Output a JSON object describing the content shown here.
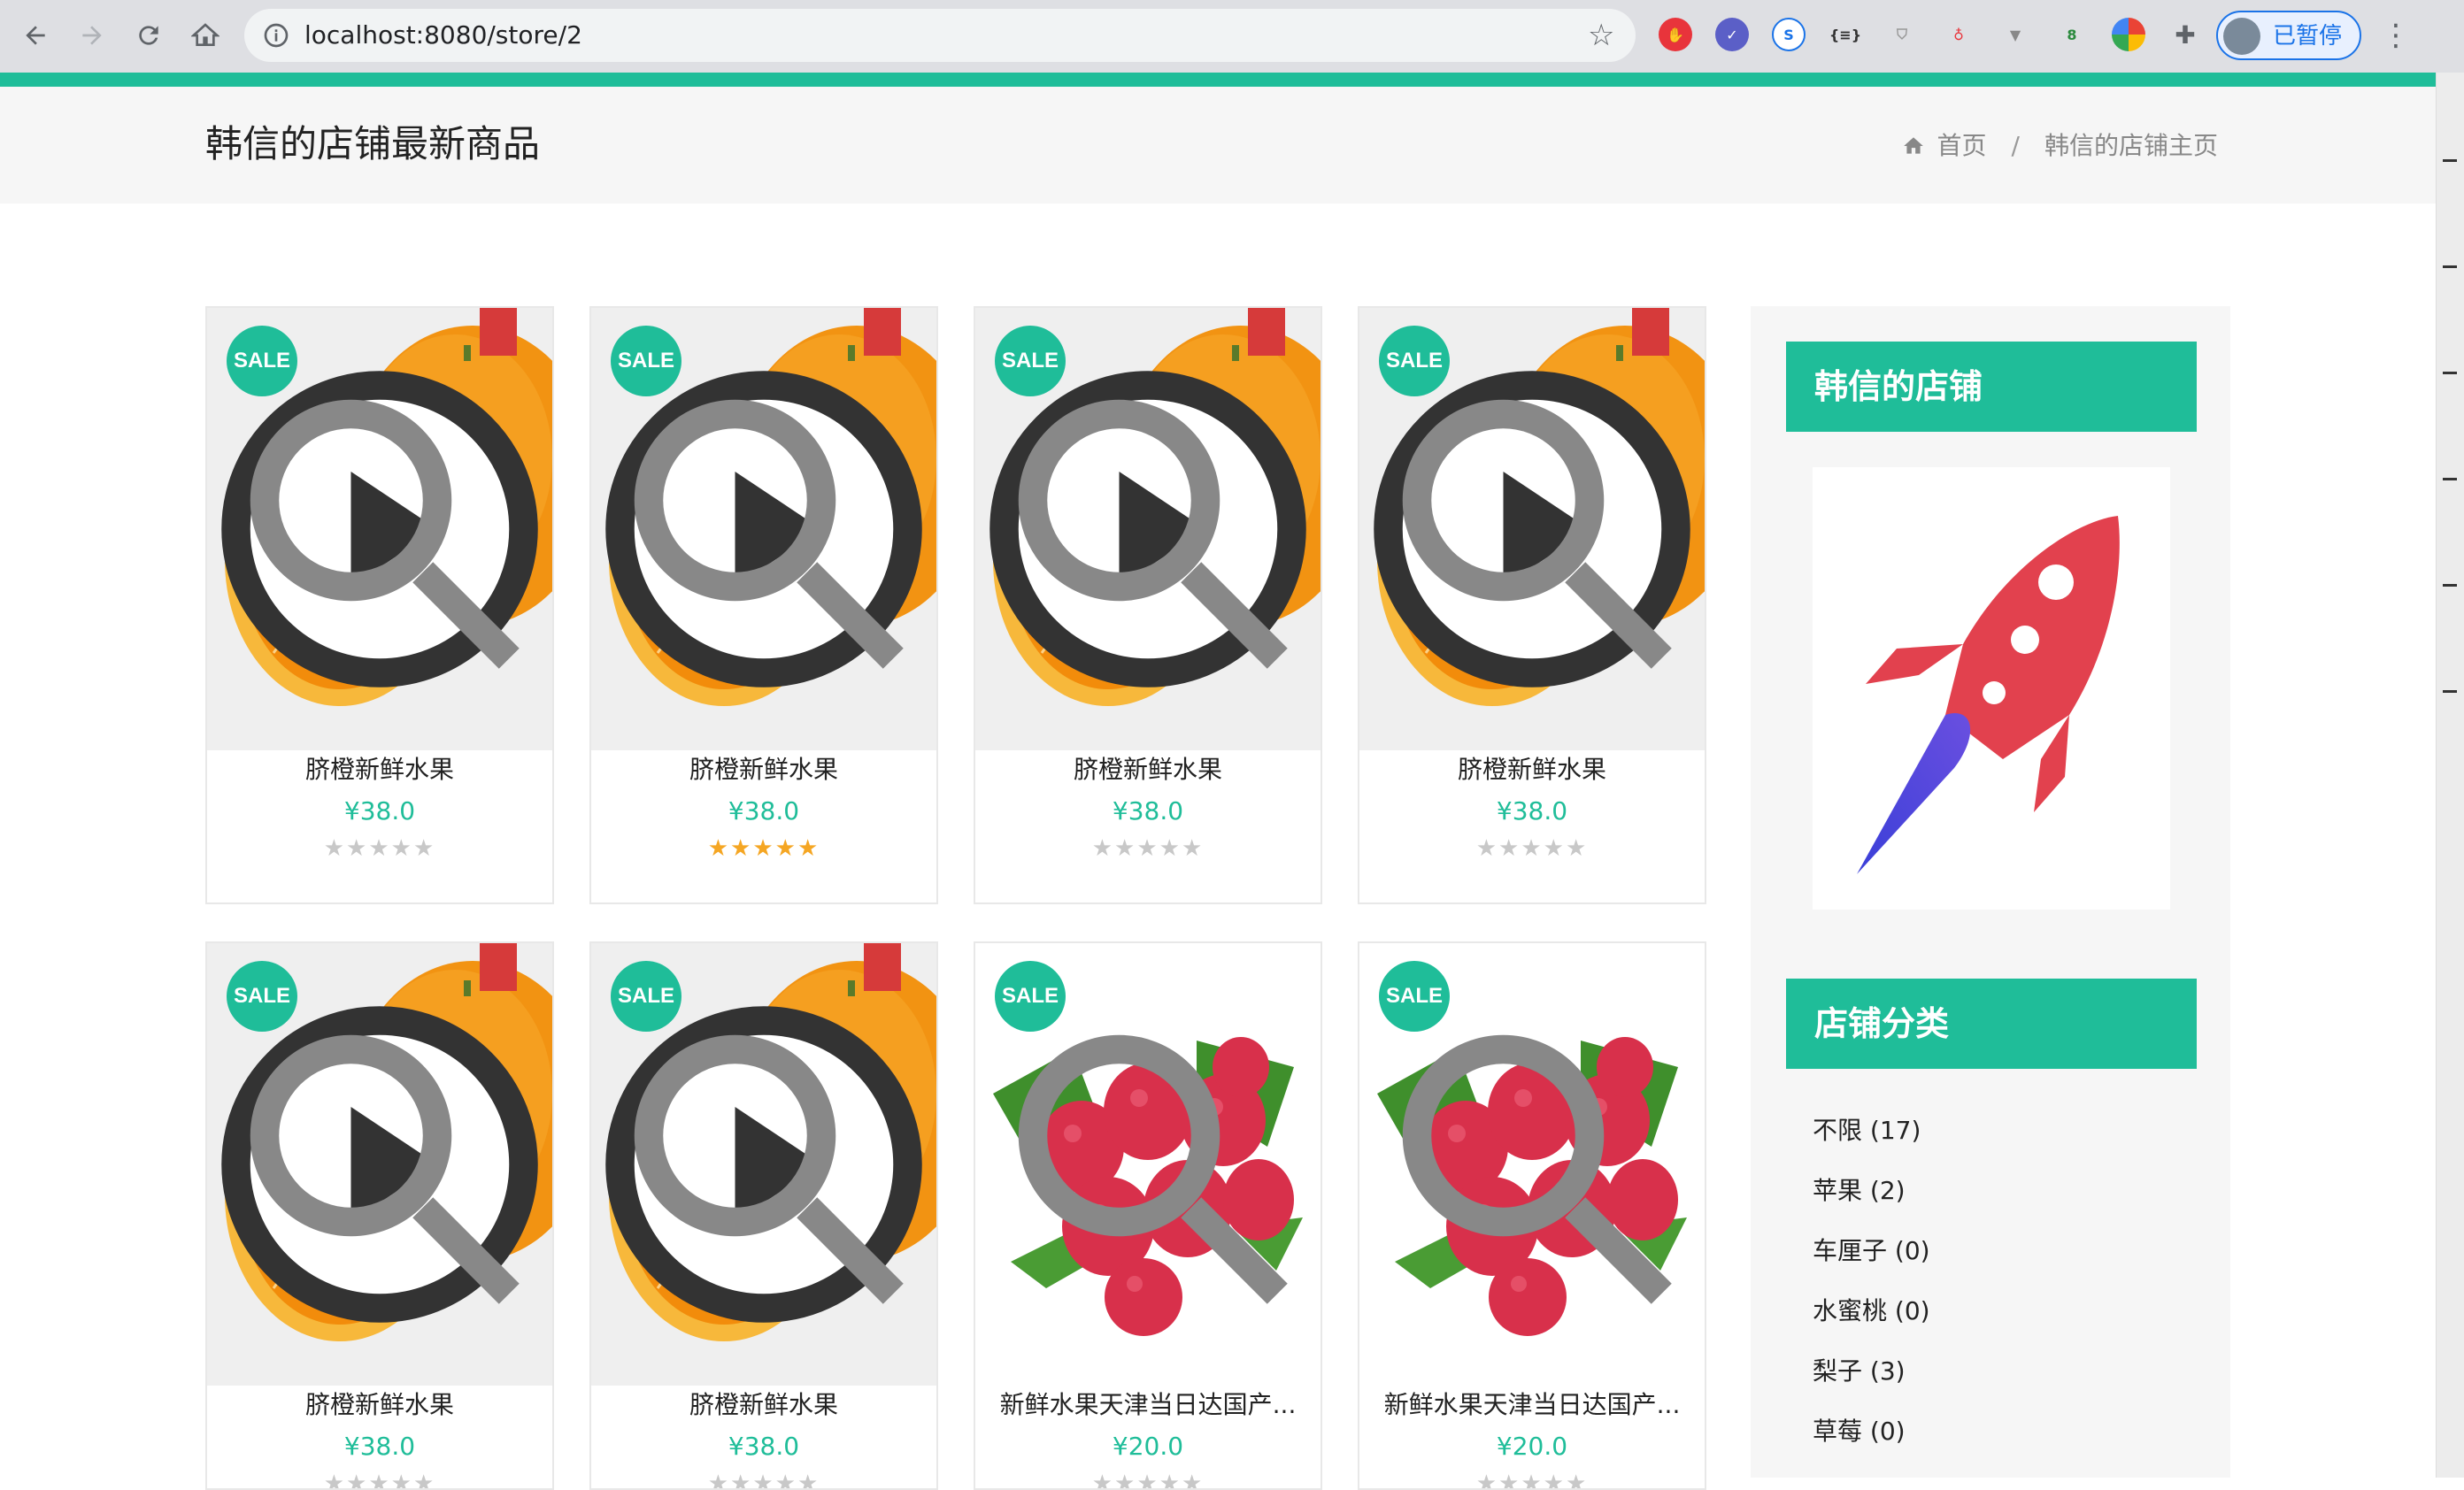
{
  "browser": {
    "url": "localhost:8080/store/2",
    "profile_label": "已暂停"
  },
  "header": {
    "title": "韩信的店铺最新商品",
    "breadcrumb": [
      "首页",
      "韩信的店铺主页"
    ]
  },
  "products": [
    {
      "name": "脐橙新鲜水果",
      "price": "¥38.0",
      "sale_label": "SALE",
      "image": "orange",
      "rating": 0
    },
    {
      "name": "脐橙新鲜水果",
      "price": "¥38.0",
      "sale_label": "SALE",
      "image": "orange",
      "rating": 5
    },
    {
      "name": "脐橙新鲜水果",
      "price": "¥38.0",
      "sale_label": "SALE",
      "image": "orange",
      "rating": 0
    },
    {
      "name": "脐橙新鲜水果",
      "price": "¥38.0",
      "sale_label": "SALE",
      "image": "orange",
      "rating": 0
    },
    {
      "name": "脐橙新鲜水果",
      "price": "¥38.0",
      "sale_label": "SALE",
      "image": "orange",
      "rating": 0
    },
    {
      "name": "脐橙新鲜水果",
      "price": "¥38.0",
      "sale_label": "SALE",
      "image": "orange",
      "rating": 0
    },
    {
      "name": "新鲜水果天津当日达国产...",
      "price": "¥20.0",
      "sale_label": "SALE",
      "image": "raspberry",
      "rating": 0
    },
    {
      "name": "新鲜水果天津当日达国产...",
      "price": "¥20.0",
      "sale_label": "SALE",
      "image": "raspberry",
      "rating": 0
    }
  ],
  "sidebar": {
    "store_title": "韩信的店铺",
    "category_title": "店铺分类",
    "categories": [
      "不限 (17)",
      "苹果 (2)",
      "车厘子 (0)",
      "水蜜桃 (0)",
      "梨子 (3)",
      "草莓 (0)"
    ]
  },
  "colors": {
    "accent": "#1fbd99",
    "star_active": "#f5a623",
    "star_inactive": "#c8c8c8"
  }
}
